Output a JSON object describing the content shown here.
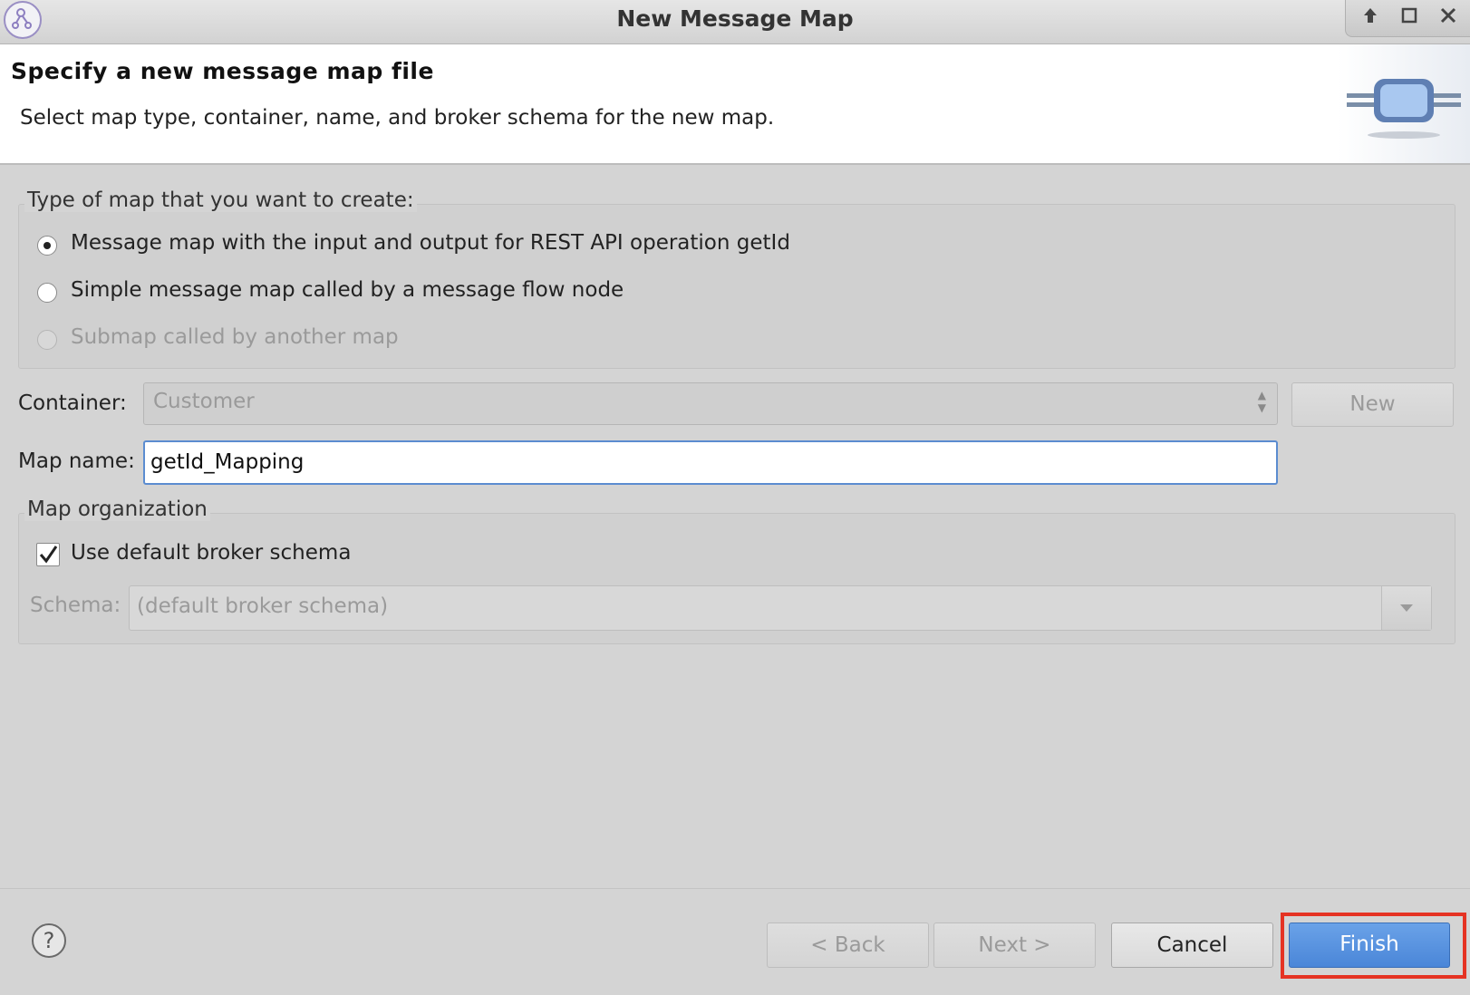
{
  "window": {
    "title": "New Message Map",
    "icons": {
      "app": "app-logo-icon",
      "minimize": "arrow-up-icon",
      "maximize": "maximize-icon",
      "close": "close-icon"
    }
  },
  "header": {
    "heading": "Specify a new message map file",
    "description": "Select map type, container, name, and broker schema for the new map.",
    "image_icon": "message-map-wizard-icon"
  },
  "map_type": {
    "legend": "Type of map that you want to create:",
    "options": [
      {
        "label": "Message map with the input and output for REST API operation getId",
        "selected": true,
        "enabled": true
      },
      {
        "label": "Simple message map called by a message flow node",
        "selected": false,
        "enabled": true
      },
      {
        "label": "Submap called by another map",
        "selected": false,
        "enabled": false
      }
    ]
  },
  "container": {
    "label": "Container:",
    "value": "Customer",
    "new_button": "New"
  },
  "map_name": {
    "label": "Map name:",
    "value": "getId_Mapping"
  },
  "organization": {
    "legend": "Map organization",
    "use_default_label": "Use default broker schema",
    "use_default_checked": true,
    "schema_label": "Schema:",
    "schema_value": "(default broker schema)"
  },
  "footer": {
    "help_icon": "help-icon",
    "back": "< Back",
    "next": "Next >",
    "cancel": "Cancel",
    "finish": "Finish",
    "accent": "#4a86d8",
    "highlight": "#e53323"
  }
}
